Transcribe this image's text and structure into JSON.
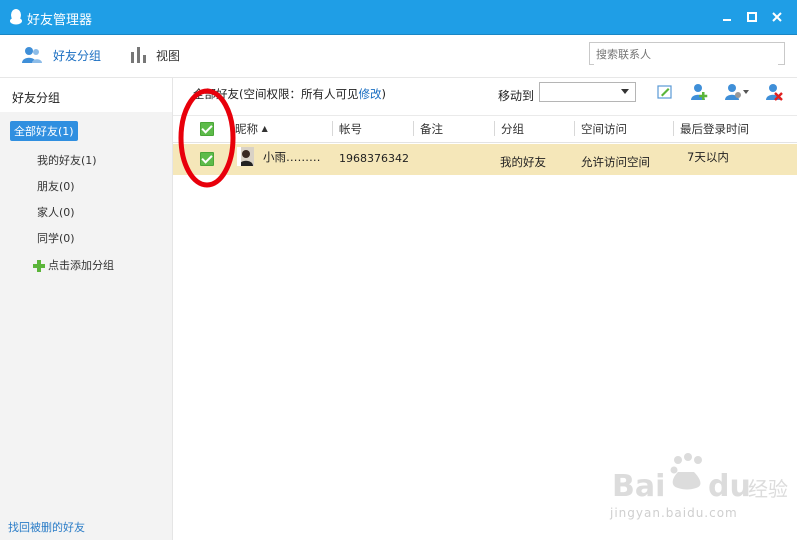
{
  "window": {
    "title": "好友管理器",
    "icon": "qq-penguin-icon",
    "controls": [
      "minimize-icon",
      "maximize-icon",
      "close-icon"
    ]
  },
  "toolbar": {
    "groups_label": "好友分组",
    "view_label": "视图",
    "search_placeholder": "搜索联系人"
  },
  "sidebar": {
    "header": "好友分组",
    "all_friends": "全部好友(1)",
    "groups": [
      {
        "label": "我的好友(1)"
      },
      {
        "label": "朋友(0)"
      },
      {
        "label": "家人(0)"
      },
      {
        "label": "同学(0)"
      }
    ],
    "add_group": "点击添加分组",
    "footer_link": "找回被删的好友"
  },
  "main": {
    "crumb_prefix": "全部好友(空间权限：所有人可见",
    "crumb_link": "修改",
    "crumb_suffix": ")",
    "move_to_label": "移动到",
    "move_to_value": "",
    "actions": [
      "edit-note-icon",
      "add-friend-icon",
      "friend-settings-icon",
      "delete-friend-icon"
    ],
    "columns": [
      "昵称",
      "帐号",
      "备注",
      "分组",
      "空间访问",
      "最后登录时间"
    ],
    "sort_indicator": "▲",
    "rows": [
      {
        "checked": true,
        "nickname": "小雨………",
        "account": "1968376342",
        "remark": "",
        "group": "我的好友",
        "space_access": "允许访问空间",
        "last_login": "7天以内"
      }
    ]
  },
  "watermark": {
    "brand": "Bai du 经验",
    "url": "jingyan.baidu.com"
  },
  "colors": {
    "titlebar": "#1f9ee6",
    "selected_row": "#f5e7b9",
    "active_group": "#2f8fe0",
    "annotation": "#e8000b",
    "checkbox": "#5dbb4a"
  }
}
